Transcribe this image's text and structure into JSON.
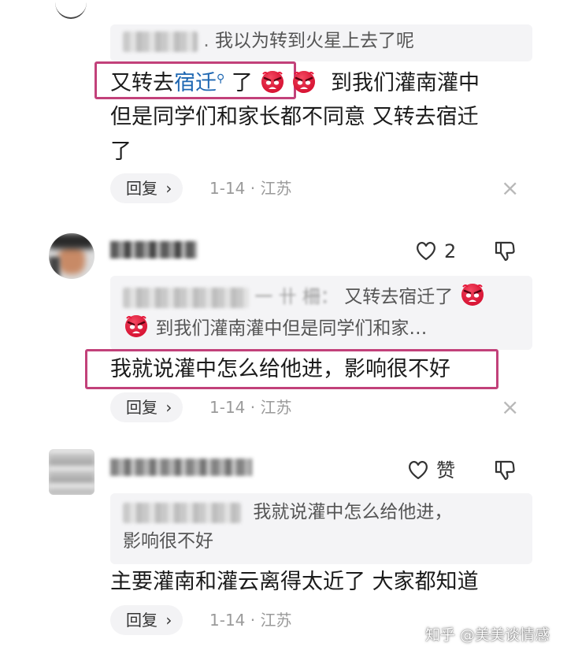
{
  "comment1": {
    "quote_text": "我以为转到火星上去了呢",
    "line1_part1": "又转去",
    "line1_link": "宿迁",
    "line1_part2": "了",
    "line1_part3": "到我们灌南灌中",
    "line2": "但是同学们和家长都不同意 又转去宿迁",
    "line3": "了",
    "reply_label": "回复",
    "date": "1-14",
    "location": "江苏"
  },
  "comment2": {
    "like_count": "2",
    "quote_line1": "又转去宿迁了",
    "quote_line2": "到我们灌南灌中但是同学们和家…",
    "text": "我就说灌中怎么给他进，影响很不好",
    "reply_label": "回复",
    "date": "1-14",
    "location": "江苏"
  },
  "comment3": {
    "like_label": "赞",
    "quote_line1": "我就说灌中怎么给他进，",
    "quote_line2": "影响很不好",
    "text": "主要灌南和灌云离得太近了 大家都知道",
    "reply_label": "回复",
    "date": "1-14",
    "location": "江苏"
  },
  "watermark": "知乎 @美美谈情感",
  "colors": {
    "highlight_border": "#c2417a",
    "link": "#1e67b2",
    "quote_bg": "#f4f4f6",
    "meta_gray": "#9a9a9a"
  },
  "icons": [
    "angry-face-emoji-icon",
    "chevron-right-icon",
    "close-icon",
    "heart-icon",
    "thumbs-down-icon"
  ]
}
